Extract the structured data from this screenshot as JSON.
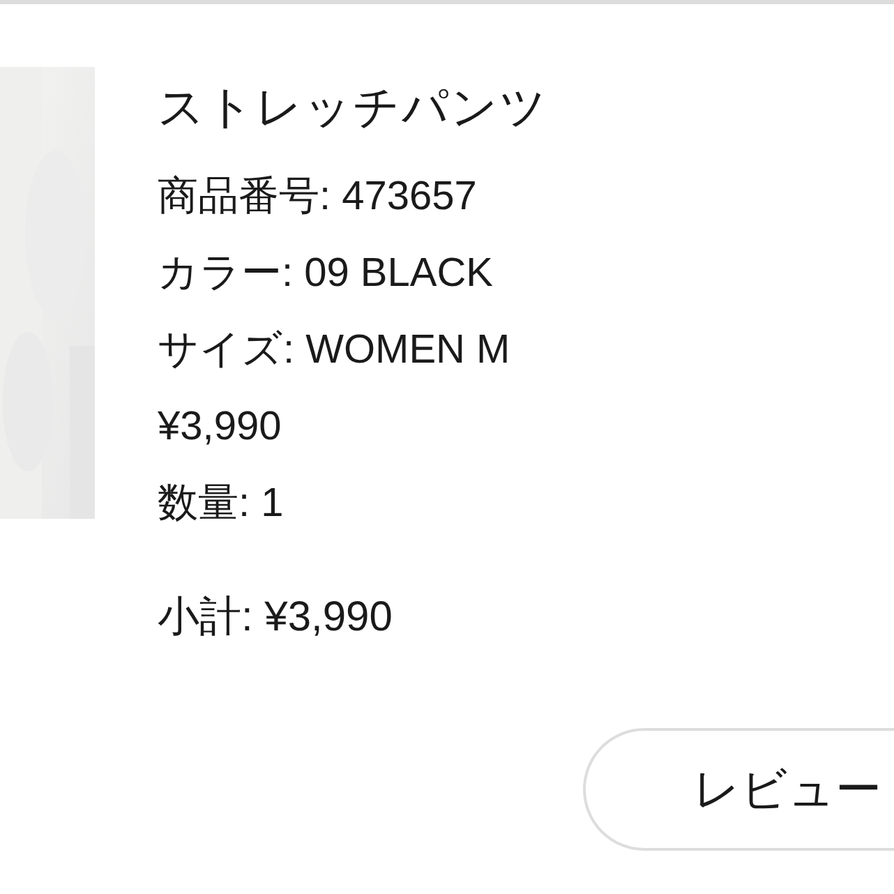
{
  "product": {
    "name": "ストレッチパンツ",
    "details": [
      "商品番号: 473657",
      "カラー: 09 BLACK",
      "サイズ: WOMEN M",
      "¥3,990",
      "数量: 1"
    ],
    "subtotal": "小計: ¥3,990"
  },
  "review_button": {
    "label": "レビュー"
  }
}
